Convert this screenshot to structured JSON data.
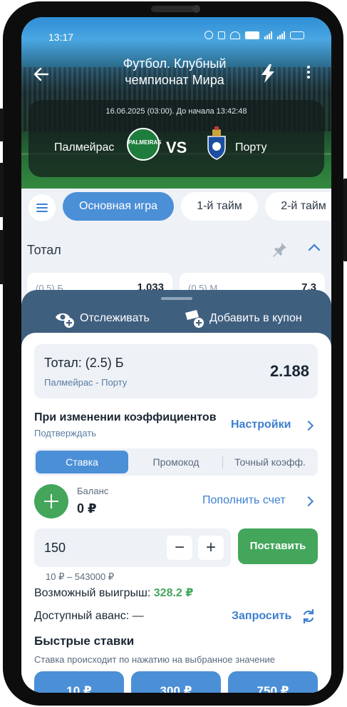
{
  "status_bar": {
    "time": "13:17"
  },
  "header": {
    "title_line1": "Футбол. Клубный",
    "title_line2": "чемпионат Мира",
    "match_date": "16.06.2025 (03:00). До начала 13:42:48",
    "team_home": "Палмейрас",
    "team_away": "Порту",
    "vs": "VS",
    "home_crest_text": "PALMEIRAS"
  },
  "tabs": [
    "Основная игра",
    "1-й тайм",
    "2-й тайм"
  ],
  "market": {
    "title": "Тотал",
    "odds": [
      {
        "label": "(0.5) Б",
        "value": "1.033"
      },
      {
        "label": "(0.5) М",
        "value": "7.3"
      }
    ]
  },
  "sheet": {
    "track_label": "Отслеживать",
    "add_coupon_label": "Добавить в купон",
    "bet": {
      "title": "Тотал: (2.5) Б",
      "match": "Палмейрас - Порту",
      "odd": "2.188"
    },
    "on_change_title": "При изменении коэффициентов",
    "on_change_value": "Подтверждать",
    "settings_label": "Настройки",
    "segments": [
      "Ставка",
      "Промокод",
      "Точный коэфф."
    ],
    "balance_label": "Баланс",
    "balance_value": "0 ₽",
    "topup_label": "Пополнить счет",
    "stake_value": "150",
    "minus": "−",
    "plus": "+",
    "place_label": "Поставить",
    "range": "10 ₽ – 543000 ₽",
    "win_label": "Возможный выигрыш:",
    "win_value": "328.2 ₽",
    "advance_label": "Доступный аванс: —",
    "request_label": "Запросить",
    "quick_title": "Быстрые ставки",
    "quick_sub": "Ставка происходит по нажатию на выбранное значение",
    "quick_amounts": [
      "10 ₽",
      "300 ₽",
      "750 ₽"
    ]
  },
  "colors": {
    "accent": "#4b8fd7",
    "green": "#43a65b",
    "sheet": "#3f5f7f"
  }
}
